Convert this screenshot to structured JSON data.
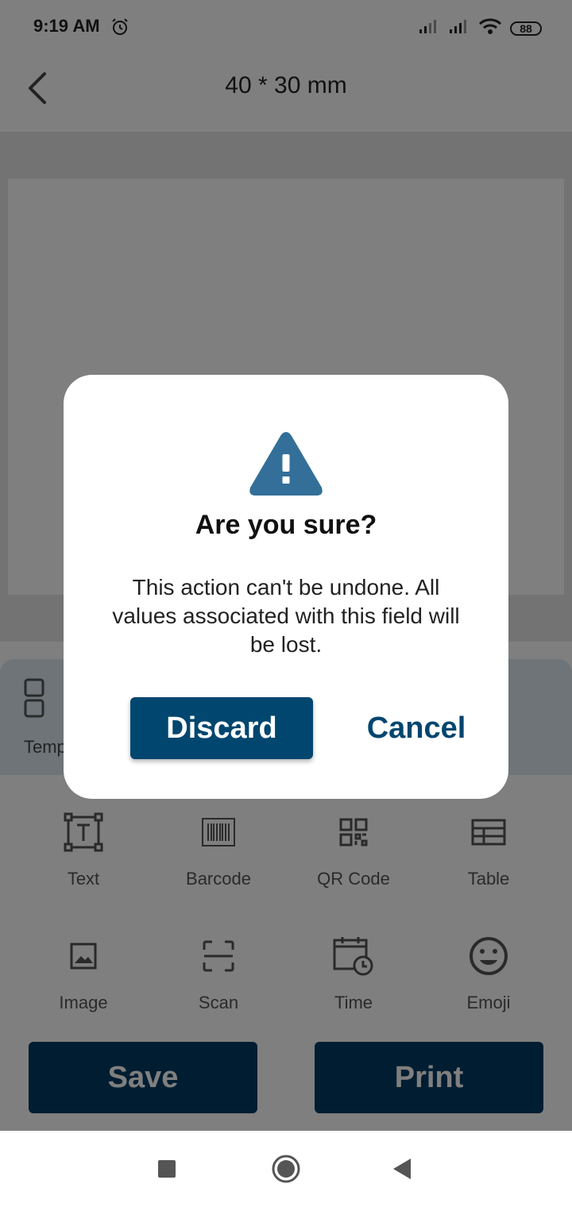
{
  "status_bar": {
    "time": "9:19 AM",
    "battery": "88"
  },
  "app_bar": {
    "title": "40 * 30 mm"
  },
  "category": {
    "template_label": "Temp"
  },
  "tools": [
    {
      "label": "Text",
      "icon": "text-box-icon"
    },
    {
      "label": "Barcode",
      "icon": "barcode-icon"
    },
    {
      "label": "QR Code",
      "icon": "qr-code-icon"
    },
    {
      "label": "Table",
      "icon": "table-icon"
    },
    {
      "label": "Image",
      "icon": "image-icon"
    },
    {
      "label": "Scan",
      "icon": "scan-icon"
    },
    {
      "label": "Time",
      "icon": "calendar-clock-icon"
    },
    {
      "label": "Emoji",
      "icon": "smiley-icon"
    }
  ],
  "actions": {
    "save": "Save",
    "print": "Print"
  },
  "dialog": {
    "title": "Are you sure?",
    "message": "This action can't be undone. All values associated with this field will be lost.",
    "discard": "Discard",
    "cancel": "Cancel"
  },
  "colors": {
    "primary": "#00466f",
    "scrim": "rgba(0,0,0,0.5)",
    "warning_icon": "#336f99"
  }
}
